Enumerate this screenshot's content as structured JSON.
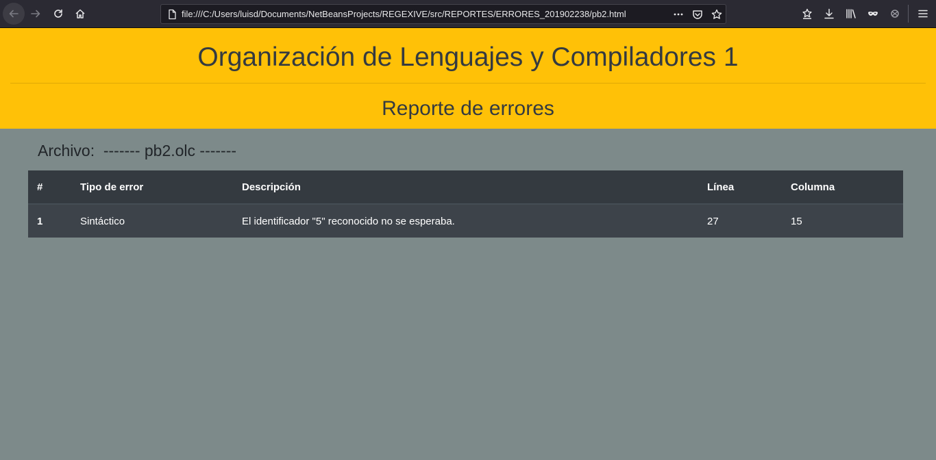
{
  "browser": {
    "url": "file:///C:/Users/luisd/Documents/NetBeansProjects/REGEXIVE/src/REPORTES/ERRORES_201902238/pb2.html"
  },
  "header": {
    "title": "Organización de Lenguajes y Compiladores 1",
    "subtitle": "Reporte de errores"
  },
  "archivo": {
    "text": "Archivo:  ------- pb2.olc -------"
  },
  "table": {
    "headers": [
      "#",
      "Tipo de error",
      "Descripción",
      "Línea",
      "Columna"
    ],
    "rows": [
      [
        "1",
        "Sintáctico",
        "El identificador \"5\" reconocido no se esperaba.",
        "27",
        "15"
      ]
    ]
  },
  "colors": {
    "header_bg": "#ffc107",
    "page_bg": "#7d8a8a",
    "table_header_bg": "#343a40",
    "table_row_bg": "#3d434a"
  }
}
